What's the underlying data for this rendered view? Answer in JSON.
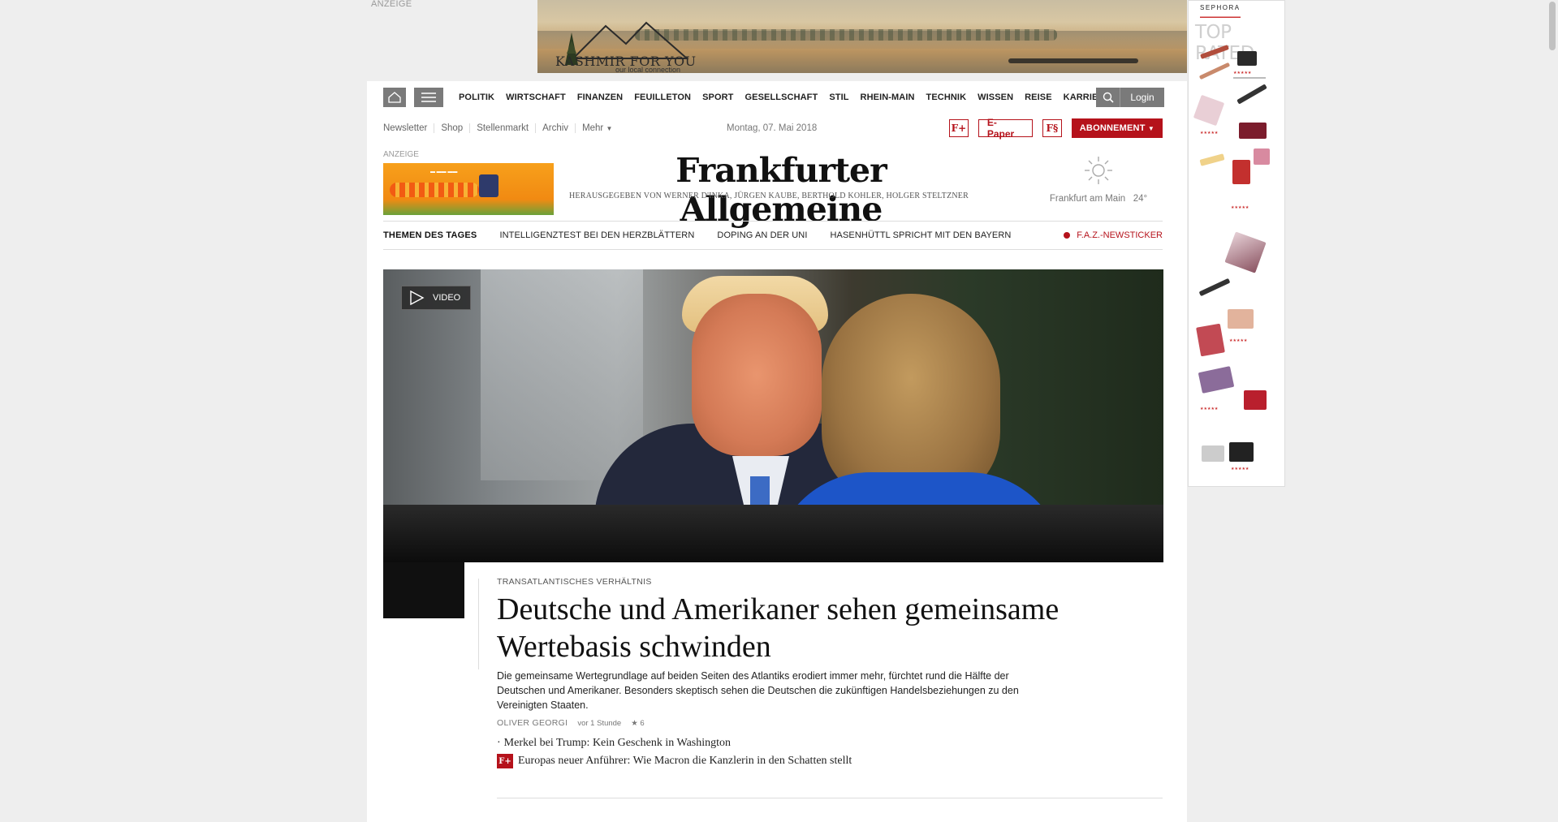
{
  "ads": {
    "top_label": "ANZEIGE",
    "banner_brand": "KASHMIR FOR YOU",
    "banner_tagline": "our local connection",
    "sky_brand": "SEPHORA",
    "sky_headline": "TOP RATED",
    "small_label": "ANZEIGE"
  },
  "nav": {
    "items": [
      "POLITIK",
      "WIRTSCHAFT",
      "FINANZEN",
      "FEUILLETON",
      "SPORT",
      "GESELLSCHAFT",
      "STIL",
      "RHEIN-MAIN",
      "TECHNIK",
      "WISSEN",
      "REISE",
      "KARRIERE"
    ],
    "login": "Login"
  },
  "service": {
    "links": [
      "Newsletter",
      "Shop",
      "Stellenmarkt",
      "Archiv",
      "Mehr"
    ],
    "date": "Montag, 07. Mai 2018",
    "plus_icon": "F+",
    "epaper": "E-Paper",
    "sonntag_icon": "F§",
    "abo": "ABONNEMENT"
  },
  "masthead": {
    "logo": "Frankfurter Allgemeine",
    "subtitle": "HERAUSGEGEBEN VON WERNER D'INKA, JÜRGEN KAUBE, BERTHOLD KOHLER, HOLGER STELTZNER"
  },
  "weather": {
    "place": "Frankfurt am Main",
    "temp": "24°",
    "icon": "sun-icon"
  },
  "themen": {
    "label": "THEMEN DES TAGES",
    "topics": [
      "INTELLIGENZTEST BEI DEN HERZBLÄTTERN",
      "DOPING AN DER UNI",
      "HASENHÜTTL SPRICHT MIT DEN BAYERN"
    ],
    "ticker": "F.A.Z.-NEWSTICKER"
  },
  "hero": {
    "badge": "VIDEO"
  },
  "article": {
    "kicker": "TRANSATLANTISCHES VERHÄLTNIS",
    "headline": "Deutsche und Amerikaner sehen gemeinsame Wertebasis schwinden",
    "teaser": "Die gemeinsame Wertegrundlage auf beiden Seiten des Atlantiks erodiert immer mehr, fürchtet rund die Hälfte der Deutschen und Amerikaner. Besonders skeptisch sehen die Deutschen die zukünftigen Handelsbeziehungen zu den Vereinigten Staaten.",
    "author": "OLIVER GEORGI",
    "time": "vor 1 Stunde",
    "comments": "6",
    "related": [
      {
        "text": "Merkel bei Trump: Kein Geschenk in Washington",
        "plus": false
      },
      {
        "text": "Europas neuer Anführer: Wie Macron die Kanzlerin in den Schatten stellt",
        "plus": true
      }
    ]
  },
  "colors": {
    "accent": "#b5121b",
    "nav_button": "#7a7a7a"
  }
}
